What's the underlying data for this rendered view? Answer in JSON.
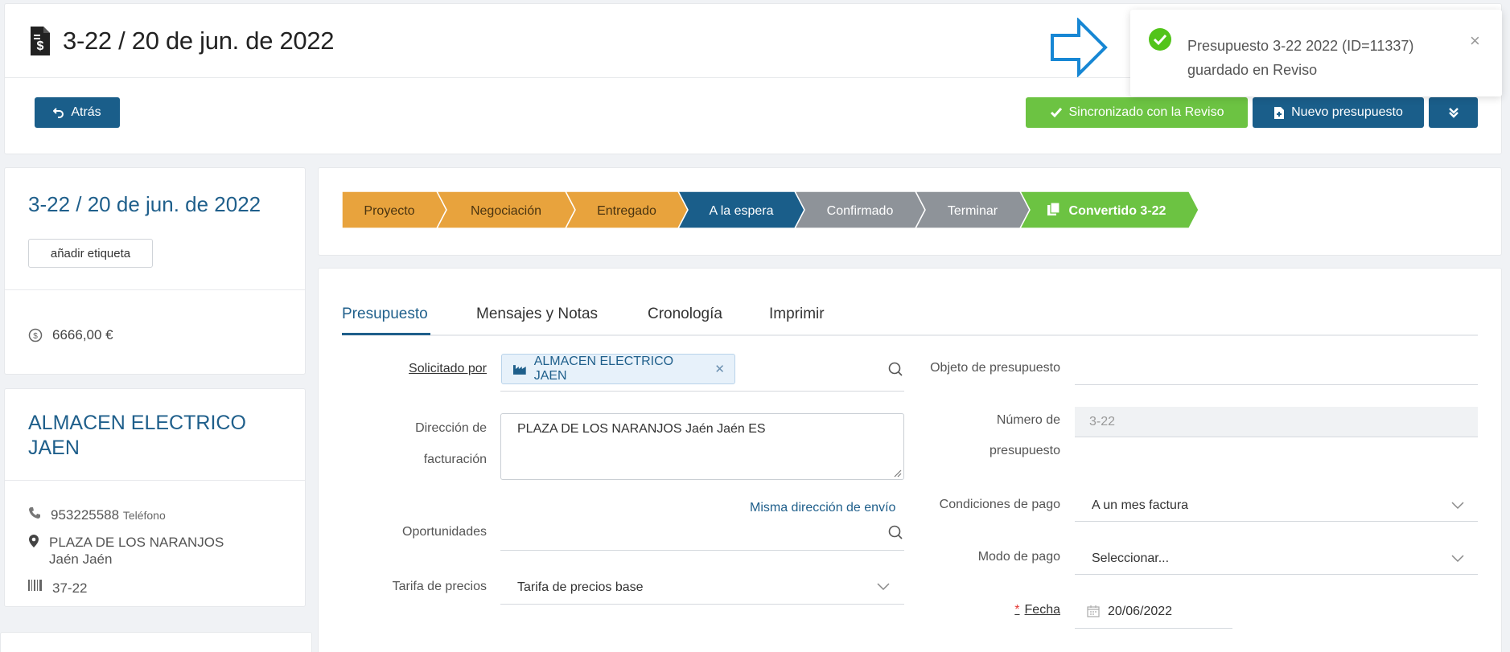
{
  "header": {
    "title": "3-22 / 20 de jun. de 2022",
    "back_label": "Atrás",
    "sync_label": "Sincronizado con la Reviso",
    "new_label": "Nuevo presupuesto"
  },
  "toast": {
    "line1": "Presupuesto   3-22   2022   (ID=11337)",
    "line2": "guardado en Reviso",
    "close": "×"
  },
  "summary": {
    "title": "3-22 / 20 de jun. de 2022",
    "tag_label": "añadir etiqueta",
    "amount": "6666,00 €"
  },
  "customer": {
    "name": "ALMACEN ELECTRICO JAEN",
    "phone": "953225588",
    "phone_label": "Teléfono",
    "address_line1": "PLAZA DE LOS NARANJOS",
    "address_line2": "Jaén Jaén",
    "code": "37-22"
  },
  "pipeline": {
    "stages": [
      {
        "label": "Proyecto",
        "color": "#e8a33d"
      },
      {
        "label": "Negociación",
        "color": "#e8a33d"
      },
      {
        "label": "Entregado",
        "color": "#e8a33d"
      },
      {
        "label": "A la espera",
        "color": "#1a5e8a"
      },
      {
        "label": "Confirmado",
        "color": "#8e9399"
      },
      {
        "label": "Terminar",
        "color": "#8e9399"
      },
      {
        "label": "Convertido 3-22",
        "color": "#6cc342"
      }
    ]
  },
  "tabs": [
    "Presupuesto",
    "Mensajes y Notas",
    "Cronología",
    "Imprimir"
  ],
  "form": {
    "requested_by_label": "Solicitado por",
    "requested_by_value": "ALMACEN ELECTRICO JAEN",
    "billing_label_1": "Dirección de",
    "billing_label_2": "facturación",
    "billing_value": "PLAZA DE LOS NARANJOS Jaén Jaén  ES",
    "same_address_link": "Misma dirección de envío",
    "opportunities_label": "Oportunidades",
    "price_list_label": "Tarifa de precios",
    "price_list_value": "Tarifa de precios base",
    "object_label": "Objeto de presupuesto",
    "number_label_1": "Número de",
    "number_label_2": "presupuesto",
    "number_value": "3-22",
    "payment_terms_label": "Condiciones de pago",
    "payment_terms_value": "A un mes factura",
    "payment_mode_label": "Modo de pago",
    "payment_mode_value": "Seleccionar...",
    "date_label": "Fecha",
    "date_value": "20/06/2022"
  },
  "colors": {
    "primary": "#1a5e8a",
    "success": "#6cc342",
    "warning": "#e8a33d",
    "muted": "#8e9399"
  }
}
